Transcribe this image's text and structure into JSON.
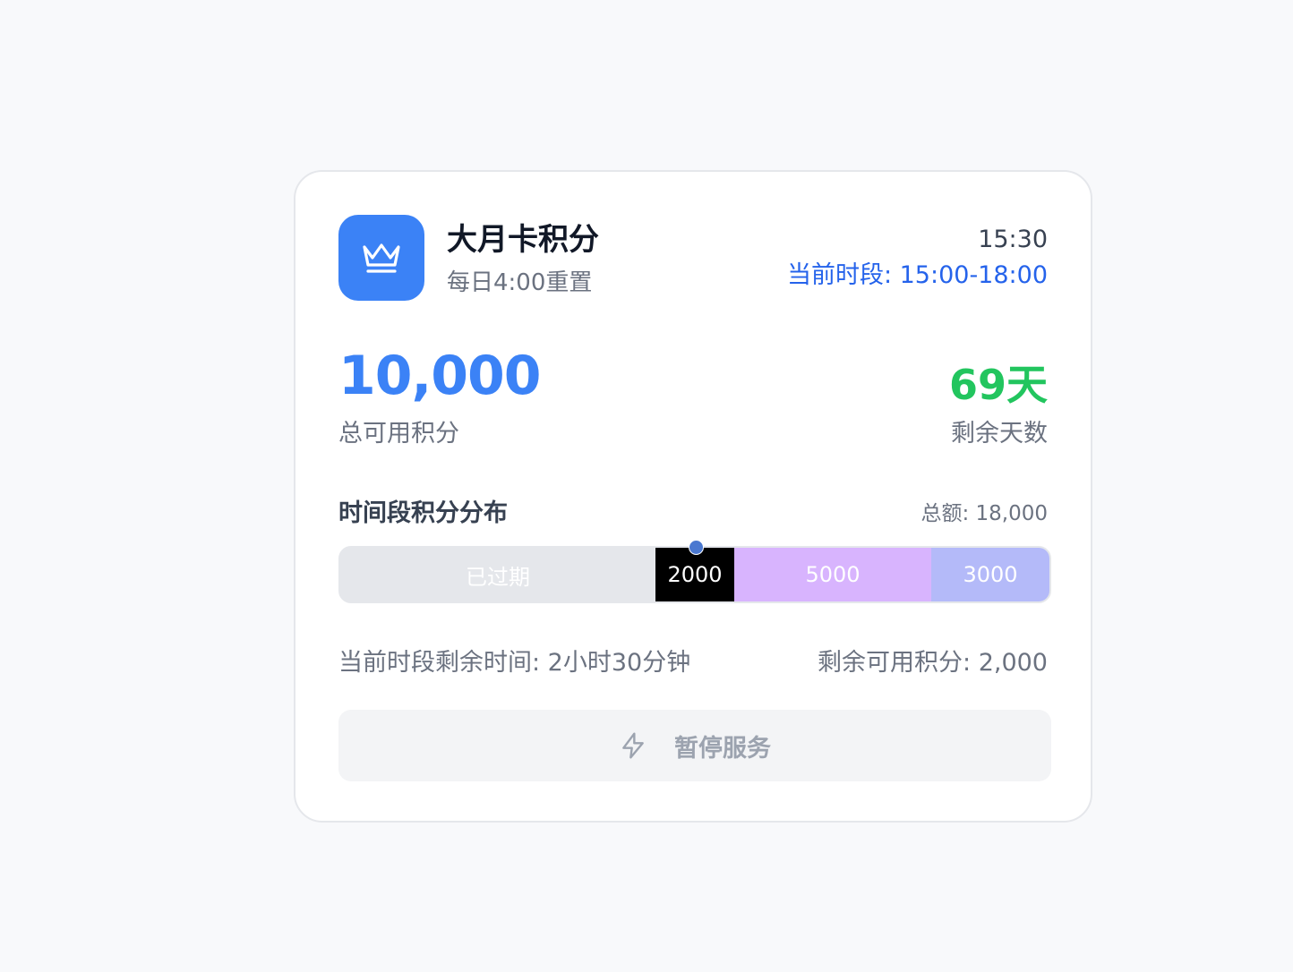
{
  "card": {
    "icon": "crown-icon",
    "title": "大月卡积分",
    "subtitle": "每日4:00重置",
    "clock": "15:30",
    "current_period": "当前时段: 15:00-18:00"
  },
  "stats": {
    "total_points": "10,000",
    "total_points_label": "总可用积分",
    "days_left": "69天",
    "days_left_label": "剩余天数"
  },
  "distribution": {
    "title": "时间段积分分布",
    "sum": "总额: 18,000",
    "total": 18000,
    "segments": [
      {
        "label": "已过期",
        "value": 8000,
        "color": "#e5e7eb"
      },
      {
        "label": "2000",
        "value": 2000,
        "color": "#000000"
      },
      {
        "label": "5000",
        "value": 5000,
        "color": "#d8b4fe"
      },
      {
        "label": "3000",
        "value": 3000,
        "color": "#b4baf9"
      }
    ],
    "marker_color": "#4a78d0"
  },
  "footer": {
    "remaining_time": "当前时段剩余时间: 2小时30分钟",
    "remaining_points": "剩余可用积分: 2,000"
  },
  "pause_button": {
    "icon": "lightning-icon",
    "label": "暂停服务"
  },
  "colors": {
    "accent": "#3b82f6",
    "period_text": "#2563eb",
    "days": "#22c55e"
  }
}
